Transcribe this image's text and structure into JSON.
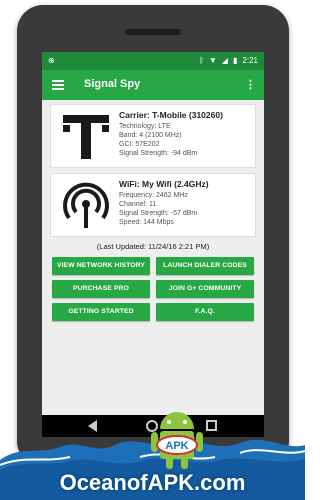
{
  "status_bar": {
    "time": "2:21"
  },
  "toolbar": {
    "title": "Signal Spy"
  },
  "carrier": {
    "title": "Carrier: T-Mobile (310260)",
    "lines": [
      "Technology: LTE",
      "Band: 4 (2100 MHz)",
      "GCI: 57E202",
      "Signal Strength: -94 dBm"
    ]
  },
  "wifi": {
    "title": "WiFi: My Wifi (2.4GHz)",
    "lines": [
      "Frequency: 2462 MHz",
      "Channel: 11",
      "Signal Strength: -57 dBm",
      "Speed: 144 Mbps"
    ]
  },
  "last_updated": "(Last Updated: 11/24/16 2:21 PM)",
  "buttons": {
    "view_history": "VIEW NETWORK HISTORY",
    "launch_dialer": "LAUNCH DIALER CODES",
    "purchase_pro": "PURCHASE PRO",
    "join_community": "JOIN G+ COMMUNITY",
    "getting_started": "GETTING STARTED",
    "faq": "F.A.Q."
  },
  "watermark": {
    "brand": "OceanofAPK.com",
    "badge": "APK"
  },
  "colors": {
    "accent": "#27a844",
    "statusbar": "#1f8a3a",
    "tmobile": "#1a1a1a"
  }
}
